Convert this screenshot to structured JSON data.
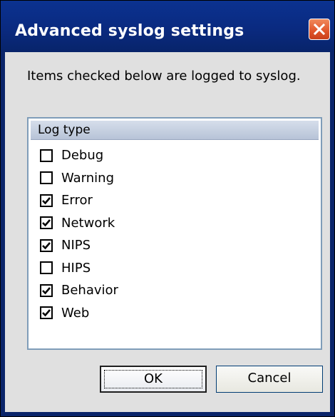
{
  "window": {
    "title": "Advanced syslog settings",
    "close_icon": "close-icon"
  },
  "hint": "Items checked below are logged to syslog.",
  "list": {
    "header": "Log type",
    "items": [
      {
        "label": "Debug",
        "checked": false
      },
      {
        "label": "Warning",
        "checked": false
      },
      {
        "label": "Error",
        "checked": true
      },
      {
        "label": "Network",
        "checked": true
      },
      {
        "label": "NIPS",
        "checked": true
      },
      {
        "label": "HIPS",
        "checked": false
      },
      {
        "label": "Behavior",
        "checked": true
      },
      {
        "label": "Web",
        "checked": true
      }
    ]
  },
  "buttons": {
    "ok": "OK",
    "cancel": "Cancel"
  },
  "colors": {
    "titlebar": "#0a2a80",
    "client": "#0a246a",
    "close": "#e0542a"
  }
}
